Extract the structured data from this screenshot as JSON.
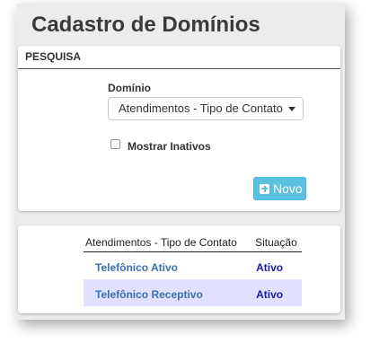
{
  "page": {
    "title": "Cadastro de Domínios"
  },
  "search_panel": {
    "heading": "PESQUISA",
    "domain_label": "Domínio",
    "domain_selected": "Atendimentos - Tipo de Contato",
    "show_inactive_label": "Mostrar Inativos",
    "show_inactive_checked": false,
    "new_button_label": "Novo"
  },
  "results": {
    "columns": [
      "Atendimentos - Tipo de Contato",
      "Situação"
    ],
    "rows": [
      {
        "name": "Telefônico Ativo",
        "status": "Ativo"
      },
      {
        "name": "Telefônico Receptivo",
        "status": "Ativo"
      }
    ]
  }
}
